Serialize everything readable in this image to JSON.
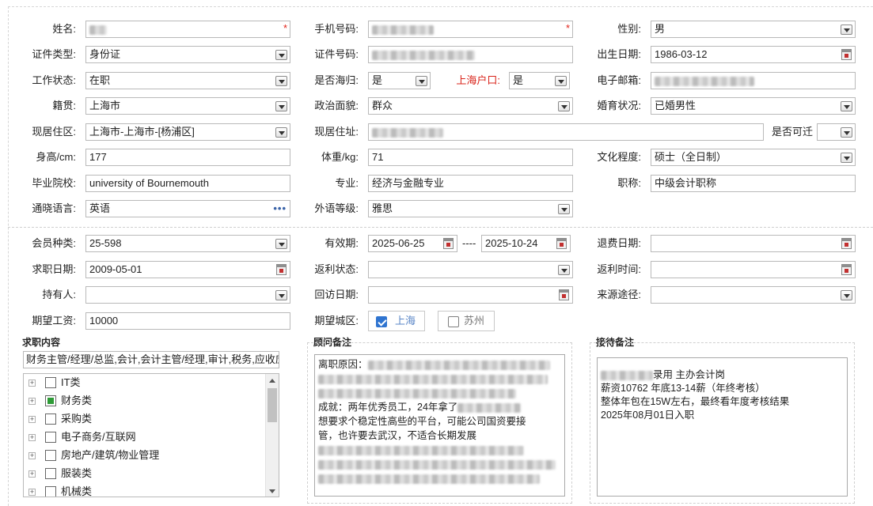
{
  "form": {
    "name": {
      "label": "姓名:",
      "value": "",
      "required": "*"
    },
    "phone": {
      "label": "手机号码:",
      "value": "",
      "required": "*"
    },
    "gender": {
      "label": "性别:",
      "value": "男"
    },
    "id_type": {
      "label": "证件类型:",
      "value": "身份证"
    },
    "id_number": {
      "label": "证件号码:",
      "value": ""
    },
    "birth_date": {
      "label": "出生日期:",
      "value": "1986-03-12"
    },
    "work_status": {
      "label": "工作状态:",
      "value": "在职"
    },
    "overseas": {
      "label": "是否海归:",
      "value": "是"
    },
    "sh_hukou": {
      "label": "上海户口:",
      "value": "是"
    },
    "email": {
      "label": "电子邮箱:",
      "value": ""
    },
    "hometown": {
      "label": "籍贯:",
      "value": "上海市"
    },
    "political": {
      "label": "政治面貌:",
      "value": "群众"
    },
    "marital": {
      "label": "婚育状况:",
      "value": "已婚男性"
    },
    "residence_area": {
      "label": "现居住区:",
      "value": "上海市-上海市-[杨浦区]"
    },
    "address": {
      "label": "现居住址:",
      "value": ""
    },
    "relocate": {
      "label": "是否可迁",
      "value": ""
    },
    "height": {
      "label": "身高/cm:",
      "value": "177"
    },
    "weight": {
      "label": "体重/kg:",
      "value": "71"
    },
    "education": {
      "label": "文化程度:",
      "value": "硕士（全日制）"
    },
    "school": {
      "label": "毕业院校:",
      "value": "university of Bournemouth"
    },
    "major": {
      "label": "专业:",
      "value": "经济与金融专业"
    },
    "title": {
      "label": "职称:",
      "value": "中级会计职称"
    },
    "languages": {
      "label": "通晓语言:",
      "value": "英语"
    },
    "lang_level": {
      "label": "外语等级:",
      "value": "雅思"
    },
    "member_type": {
      "label": "会员种类:",
      "value": "25-598"
    },
    "valid_period": {
      "label": "有效期:",
      "from": "2025-06-25",
      "sep": "----",
      "to": "2025-10-24"
    },
    "refund_date": {
      "label": "退费日期:",
      "value": ""
    },
    "job_seek_date": {
      "label": "求职日期:",
      "value": "2009-05-01"
    },
    "rebate_status": {
      "label": "返利状态:",
      "value": ""
    },
    "rebate_time": {
      "label": "返利时间:",
      "value": ""
    },
    "holder": {
      "label": "持有人:",
      "value": ""
    },
    "revisit_date": {
      "label": "回访日期:",
      "value": ""
    },
    "source": {
      "label": "来源途径:",
      "value": ""
    },
    "expected_salary": {
      "label": "期望工资:",
      "value": "10000"
    },
    "expected_city": {
      "label": "期望城区:",
      "options": [
        {
          "label": "上海",
          "checked": true
        },
        {
          "label": "苏州",
          "checked": false
        }
      ]
    }
  },
  "job_content": {
    "title": "求职内容",
    "summary": "财务主管/经理/总监,会计,会计主管/经理,审计,税务,应收应",
    "tree": [
      {
        "label": "IT类",
        "checked": false
      },
      {
        "label": "财务类",
        "checked": true
      },
      {
        "label": "采购类",
        "checked": false
      },
      {
        "label": "电子商务/互联网",
        "checked": false
      },
      {
        "label": "房地产/建筑/物业管理",
        "checked": false
      },
      {
        "label": "服装类",
        "checked": false
      },
      {
        "label": "机械类",
        "checked": false
      }
    ]
  },
  "consultant_notes": {
    "title": "顾问备注",
    "lines": [
      {
        "text": "离职原因：",
        "blur": 230
      },
      {
        "text": "",
        "blur": 290
      },
      {
        "text": "",
        "blur": 250
      },
      {
        "text": "成就：两年优秀员工，24年拿了",
        "blur": 80
      },
      {
        "text": "想要求个稳定性高些的平台，可能公司国资要接",
        "blur": 0
      },
      {
        "text": "管，也许要去武汉，不适合长期发展",
        "blur": 0
      },
      {
        "text": "",
        "blur": 260
      },
      {
        "text": "",
        "blur": 300
      },
      {
        "text": "",
        "blur": 280
      }
    ]
  },
  "reception_notes": {
    "title": "接待备注",
    "lines": [
      {
        "text": "录用 主办会计岗",
        "blur": 66
      },
      {
        "text": "薪资10762   年底13-14薪（年终考核）",
        "blur": 0
      },
      {
        "text": "整体年包在15W左右，最终看年度考核结果",
        "blur": 0
      },
      {
        "text": "2025年08月01日入职",
        "blur": 0
      }
    ]
  }
}
